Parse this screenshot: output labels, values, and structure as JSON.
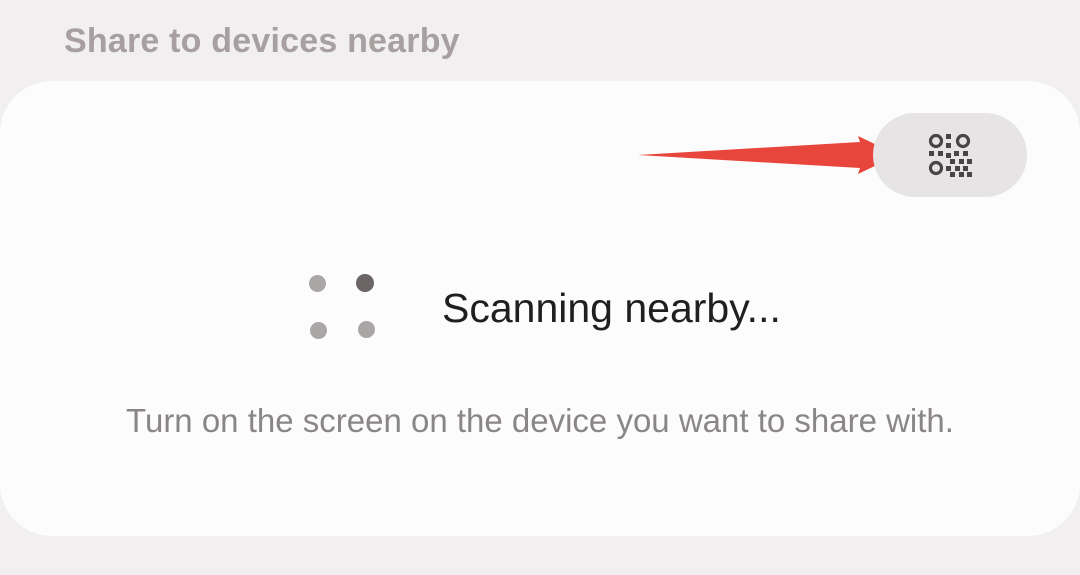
{
  "section": {
    "title": "Share to devices nearby"
  },
  "card": {
    "qr_button": {
      "icon": "qr-code-icon"
    },
    "annotation": {
      "icon": "red-arrow",
      "color": "#e8453c"
    },
    "scanning_label": "Scanning nearby...",
    "hint": "Turn on the screen on the device you want to share with."
  },
  "colors": {
    "background": "#f1efef",
    "card": "#fcfcfc",
    "qr_button_bg": "#e6e4e4",
    "title": "#a8a0a0",
    "active_dot": "#6b6565",
    "inactive_dot": "#aaa6a6"
  }
}
